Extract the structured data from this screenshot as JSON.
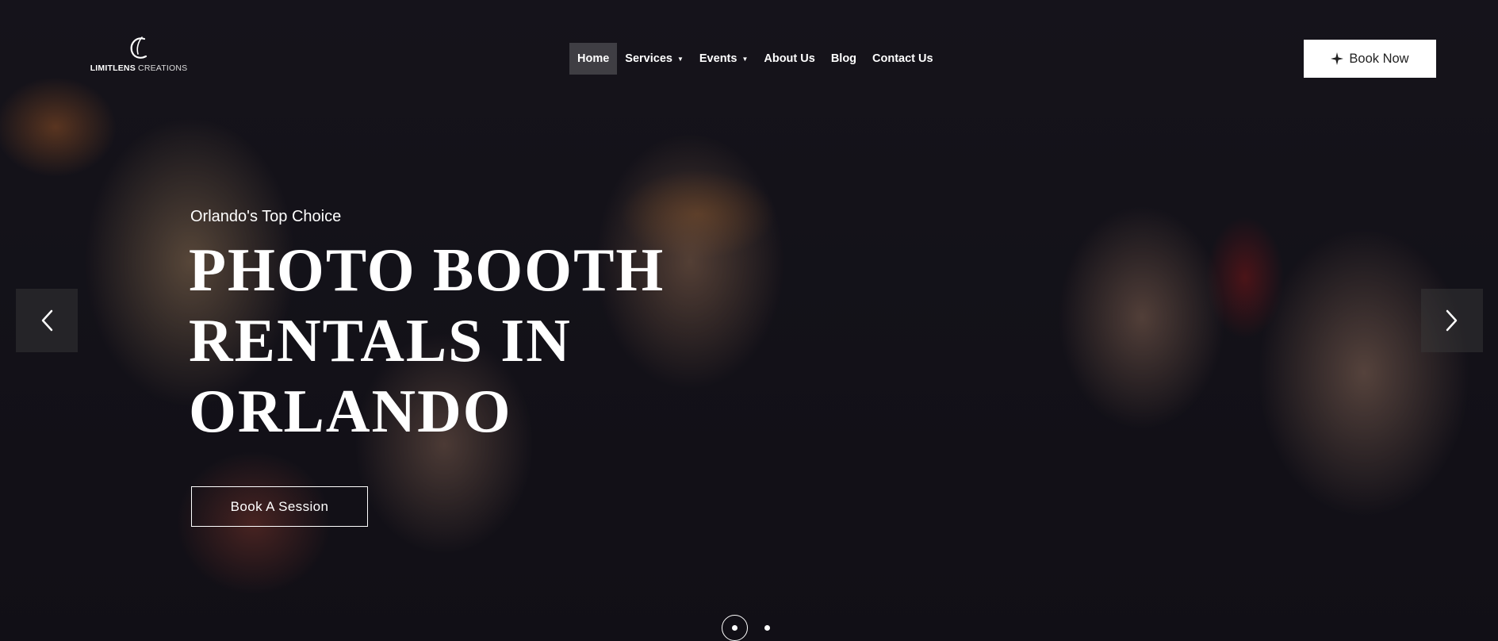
{
  "brand": {
    "name_bold": "LIMITLENS",
    "name_light": "CREATIONS",
    "logo_icon": "stylized-c-monogram-icon"
  },
  "nav": {
    "items": [
      {
        "label": "Home",
        "active": true,
        "has_dropdown": false
      },
      {
        "label": "Services",
        "active": false,
        "has_dropdown": true
      },
      {
        "label": "Events",
        "active": false,
        "has_dropdown": true
      },
      {
        "label": "About Us",
        "active": false,
        "has_dropdown": false
      },
      {
        "label": "Blog",
        "active": false,
        "has_dropdown": false
      },
      {
        "label": "Contact Us",
        "active": false,
        "has_dropdown": false
      }
    ],
    "dropdown_icon": "caret-down-icon"
  },
  "cta": {
    "book_now_label": "Book Now",
    "book_now_icon": "sparkle-icon"
  },
  "hero": {
    "eyebrow": "Orlando's Top Choice",
    "headline_lines": [
      "PHOTO BOOTH",
      "RENTALS IN",
      "ORLANDO"
    ],
    "button_label": "Book A Session"
  },
  "slider": {
    "prev_icon": "chevron-left-icon",
    "next_icon": "chevron-right-icon",
    "total_slides": 2,
    "active_slide": 1
  },
  "colors": {
    "text": "#ffffff",
    "book_now_bg": "#ffffff",
    "book_now_text": "#222222",
    "active_nav_bg": "#46464b"
  }
}
